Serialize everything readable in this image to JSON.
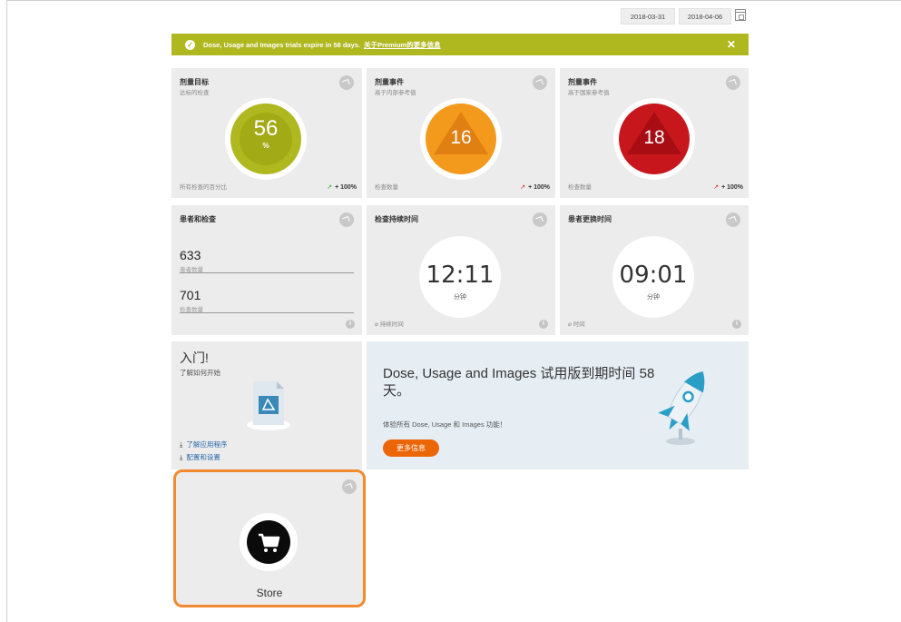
{
  "dates": {
    "start": "2018-03-31",
    "end": "2018-04-06"
  },
  "banner": {
    "message": "Dose, Usage and Images trials expire in 58 days.",
    "link": "关于Premium的更多信息",
    "close": "✕",
    "color": "#b0b820"
  },
  "cards": {
    "dose_target": {
      "title": "剂量目标",
      "subtitle": "达标的检查",
      "value": "56",
      "unit": "%",
      "footer": "所有检查的百分比",
      "trend": "+ 100%"
    },
    "dose_events_local": {
      "title": "剂量事件",
      "subtitle": "高于内部参考值",
      "value": "16",
      "footer": "检查数量",
      "trend": "+ 100%",
      "color": "#f39a1d"
    },
    "dose_events_national": {
      "title": "剂量事件",
      "subtitle": "高于国家参考值",
      "value": "18",
      "footer": "检查数量",
      "trend": "+ 100%",
      "color": "#c8161d"
    },
    "patients_exams": {
      "title": "患者和检查",
      "patients_value": "633",
      "patients_label": "患者数量",
      "exams_value": "701",
      "exams_label": "检查数量"
    },
    "exam_duration": {
      "title": "检查持续时间",
      "value": "12:11",
      "unit": "分钟",
      "footer": "⌀ 持续时间"
    },
    "patient_change": {
      "title": "患者更换时间",
      "value": "09:01",
      "unit": "分钟",
      "footer": "⌀ 时间"
    },
    "getting_started": {
      "title": "入门!",
      "subtitle": "了解如何开始",
      "link1": "了解应用程序",
      "link2": "配置和设置"
    },
    "promo": {
      "title": "Dose, Usage and Images 试用版到期时间 58 天。",
      "subtitle": "体验所有 Dose, Usage 和 Images 功能！",
      "button": "更多信息"
    },
    "store": {
      "label": "Store"
    }
  },
  "info_glyph": "i",
  "download_glyph": "⤓"
}
